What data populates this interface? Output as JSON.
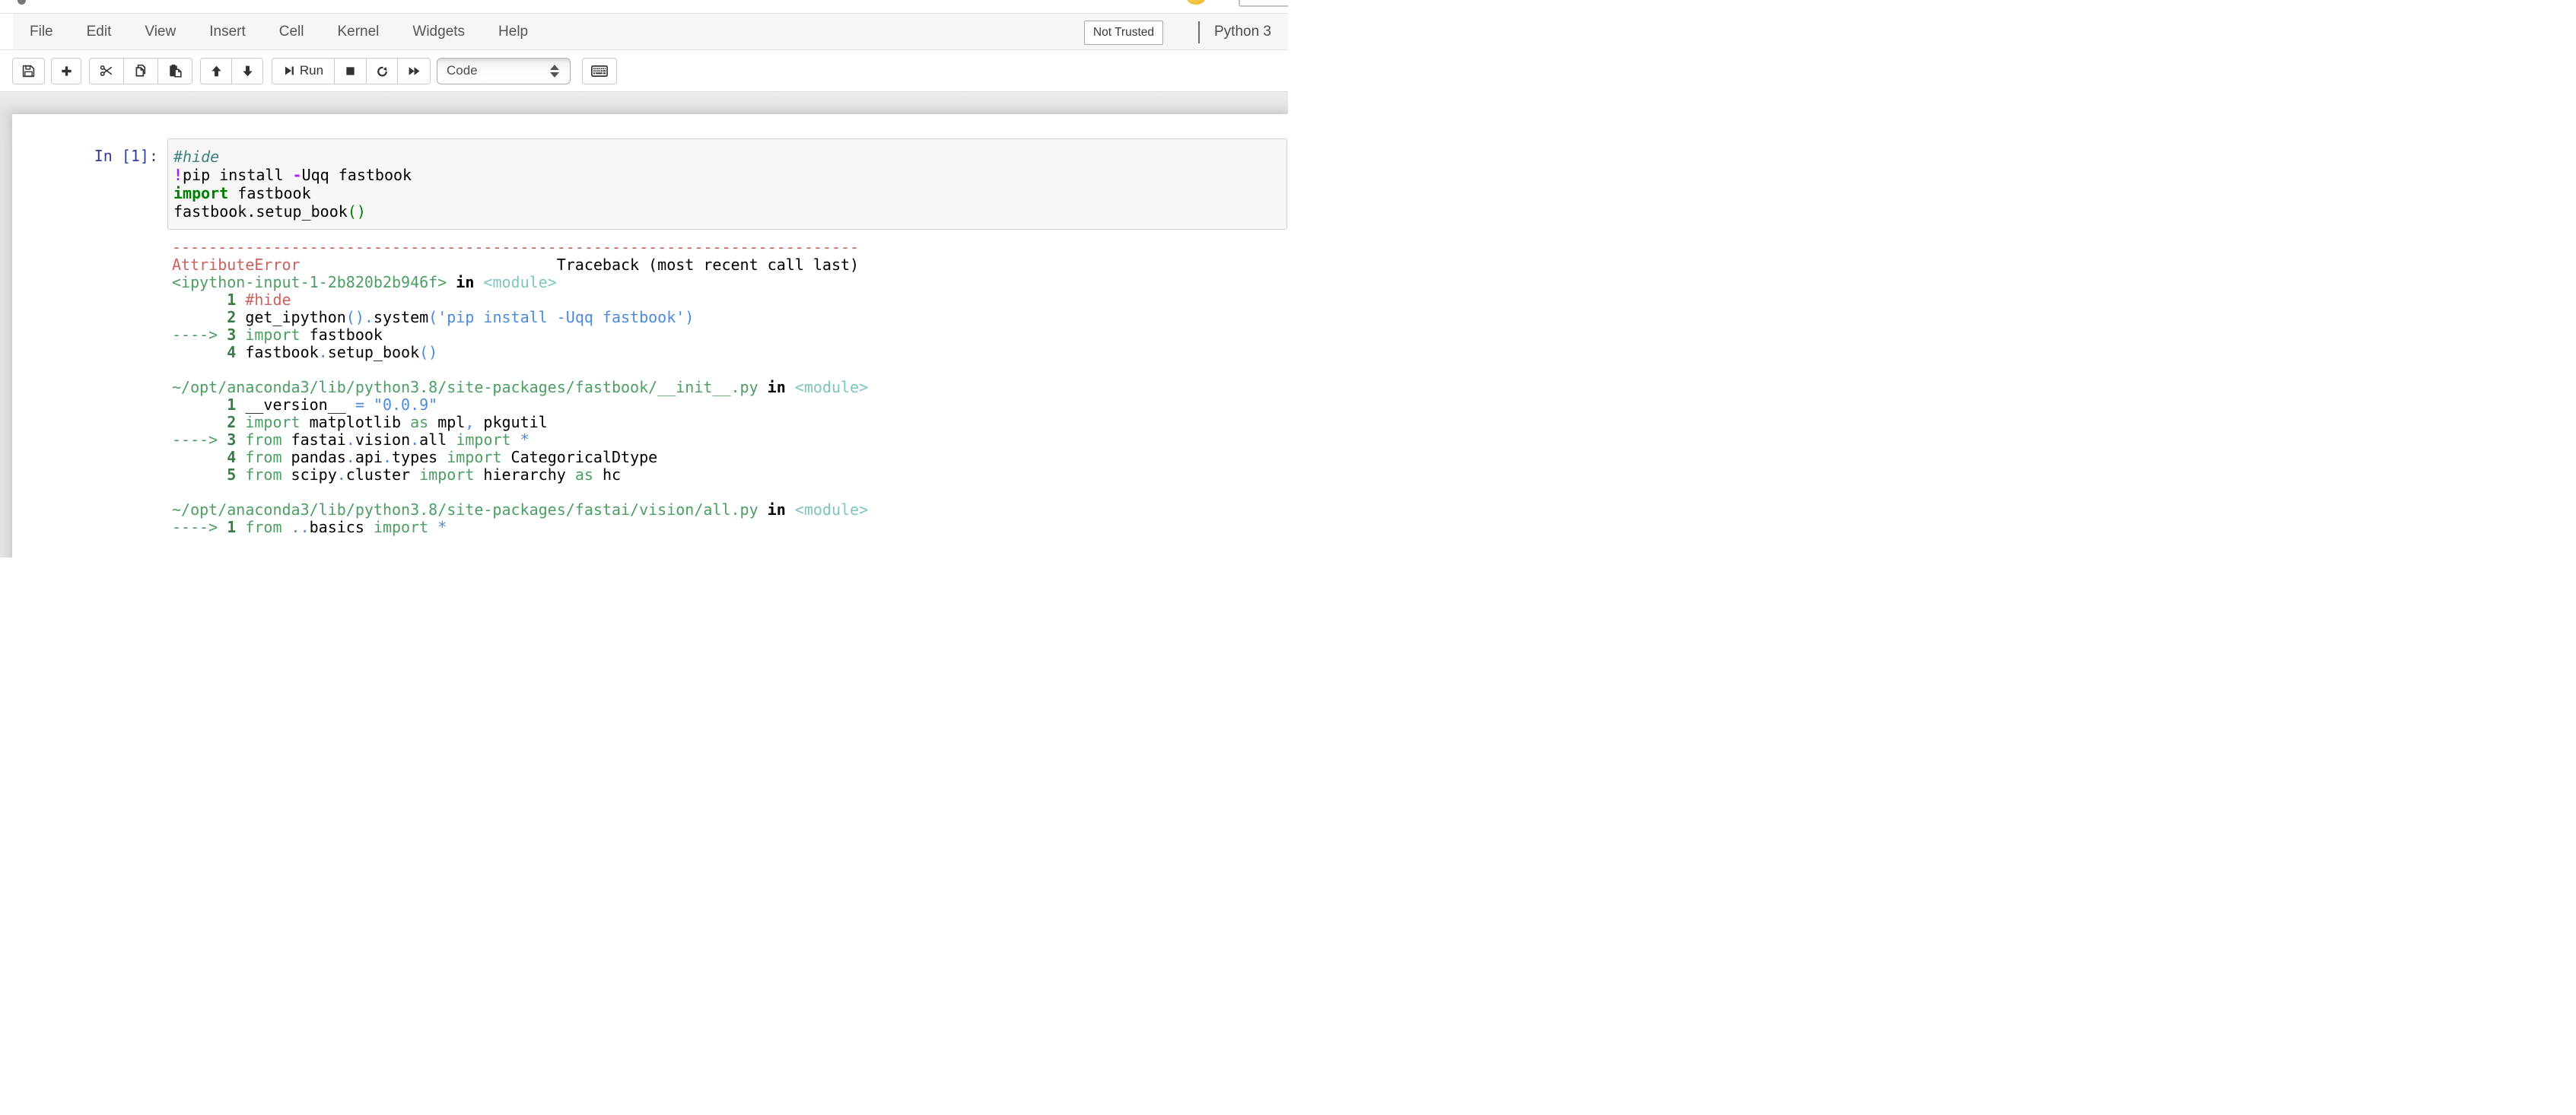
{
  "header": {
    "menu_items": [
      "File",
      "Edit",
      "View",
      "Insert",
      "Cell",
      "Kernel",
      "Widgets",
      "Help"
    ],
    "trust_status": "Not Trusted",
    "kernel_name": "Python 3"
  },
  "toolbar": {
    "run_label": "Run",
    "cell_type": "Code",
    "button_icons": [
      "save",
      "insert-cell-below",
      "cut-cells",
      "copy-cells",
      "paste-cells",
      "move-cell-up",
      "move-cell-down",
      "run-cell",
      "interrupt-kernel",
      "restart-kernel",
      "restart-and-run-all",
      "command-palette"
    ]
  },
  "colors": {
    "prompt_blue": "#303F9F",
    "ansi_red": "#c9625d",
    "ansi_green": "#4c9e63",
    "ansi_dark_green": "#3a7d44",
    "ansi_cyan": "#7ec5bf",
    "ansi_blue": "#4b8bd9",
    "comment_teal": "#3f8080",
    "keyword_green": "#008000",
    "operator_purple": "#AA22FF"
  },
  "cell": {
    "prompt": "In [1]:",
    "code_lines": [
      [
        [
          "c",
          "#hide"
        ]
      ],
      [
        [
          "o",
          "!"
        ],
        [
          "t",
          "pip install "
        ],
        [
          "o",
          "-"
        ],
        [
          "t",
          "Uqq fastbook"
        ]
      ],
      [
        [
          "k",
          "import"
        ],
        [
          "t",
          " fastbook"
        ]
      ],
      [
        [
          "t",
          "fastbook.setup_book"
        ],
        [
          "p",
          "()"
        ]
      ]
    ]
  },
  "output": {
    "lines": [
      [
        [
          "r",
          "---------------------------------------------------------------------------"
        ]
      ],
      [
        [
          "r",
          "AttributeError"
        ],
        [
          "t",
          "                            Traceback (most recent call last)"
        ]
      ],
      [
        [
          "g",
          "<ipython-input-1-2b820b2b946f>"
        ],
        [
          "bold",
          " in "
        ],
        [
          "cy",
          "<module>"
        ]
      ],
      [
        [
          "gn",
          "      1 "
        ],
        [
          "r",
          "#hide"
        ]
      ],
      [
        [
          "gn",
          "      2 "
        ],
        [
          "t",
          "get_ipython"
        ],
        [
          "bl",
          "()."
        ],
        [
          "t",
          "system"
        ],
        [
          "bl",
          "('pip install -Uqq fastbook')"
        ]
      ],
      [
        [
          "g",
          "----> "
        ],
        [
          "gn",
          "3 "
        ],
        [
          "g",
          "import"
        ],
        [
          "t",
          " fastbook"
        ]
      ],
      [
        [
          "gn",
          "      4 "
        ],
        [
          "t",
          "fastbook"
        ],
        [
          "bl",
          "."
        ],
        [
          "t",
          "setup_book"
        ],
        [
          "bl",
          "()"
        ]
      ],
      [],
      [
        [
          "g",
          "~/opt/anaconda3/lib/python3.8/site-packages/fastbook/__init__.py"
        ],
        [
          "bold",
          " in "
        ],
        [
          "cy",
          "<module>"
        ]
      ],
      [
        [
          "gn",
          "      1 "
        ],
        [
          "t",
          "__version__ "
        ],
        [
          "bl",
          "= \"0.0.9\""
        ]
      ],
      [
        [
          "gn",
          "      2 "
        ],
        [
          "g",
          "import"
        ],
        [
          "t",
          " matplotlib "
        ],
        [
          "g",
          "as"
        ],
        [
          "t",
          " mpl"
        ],
        [
          "bl",
          ","
        ],
        [
          "t",
          " pkgutil"
        ]
      ],
      [
        [
          "g",
          "----> "
        ],
        [
          "gn",
          "3 "
        ],
        [
          "g",
          "from"
        ],
        [
          "t",
          " fastai"
        ],
        [
          "bl",
          "."
        ],
        [
          "t",
          "vision"
        ],
        [
          "bl",
          "."
        ],
        [
          "t",
          "all "
        ],
        [
          "g",
          "import"
        ],
        [
          "bl",
          " *"
        ]
      ],
      [
        [
          "gn",
          "      4 "
        ],
        [
          "g",
          "from"
        ],
        [
          "t",
          " pandas"
        ],
        [
          "bl",
          "."
        ],
        [
          "t",
          "api"
        ],
        [
          "bl",
          "."
        ],
        [
          "t",
          "types "
        ],
        [
          "g",
          "import"
        ],
        [
          "t",
          " CategoricalDtype"
        ]
      ],
      [
        [
          "gn",
          "      5 "
        ],
        [
          "g",
          "from"
        ],
        [
          "t",
          " scipy"
        ],
        [
          "bl",
          "."
        ],
        [
          "t",
          "cluster "
        ],
        [
          "g",
          "import"
        ],
        [
          "t",
          " hierarchy "
        ],
        [
          "g",
          "as"
        ],
        [
          "t",
          " hc"
        ]
      ],
      [],
      [
        [
          "g",
          "~/opt/anaconda3/lib/python3.8/site-packages/fastai/vision/all.py"
        ],
        [
          "bold",
          " in "
        ],
        [
          "cy",
          "<module>"
        ]
      ],
      [
        [
          "g",
          "----> "
        ],
        [
          "gn",
          "1 "
        ],
        [
          "g",
          "from"
        ],
        [
          "bl",
          " .."
        ],
        [
          "t",
          "basics "
        ],
        [
          "g",
          "import"
        ],
        [
          "bl",
          " *"
        ]
      ]
    ]
  }
}
